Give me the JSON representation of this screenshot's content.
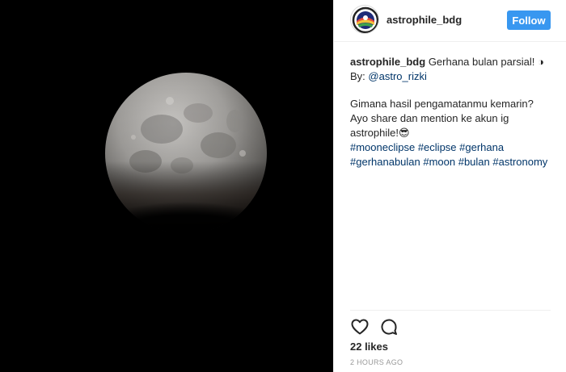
{
  "header": {
    "username": "astrophile_bdg",
    "follow_label": "Follow",
    "avatar_icon": "astrophile-logo-icon"
  },
  "caption": {
    "username": "astrophile_bdg",
    "line1": "Gerhana bulan parsial! ◑",
    "by_prefix": "By: ",
    "mention": "@astro_rizki",
    "body": "Gimana hasil pengamatanmu kemarin? Ayo share dan mention ke akun ig astrophile!😎",
    "hashtags": "#mooneclipse #eclipse #gerhana #gerhanabulan #moon #bulan #astronomy"
  },
  "actions": {
    "like_icon": "heart-icon",
    "comment_icon": "comment-icon"
  },
  "likes": "22 likes",
  "time": "2 HOURS AGO",
  "colors": {
    "follow_bg": "#3897f0",
    "link": "#003569",
    "photo_bg": "#000000"
  }
}
